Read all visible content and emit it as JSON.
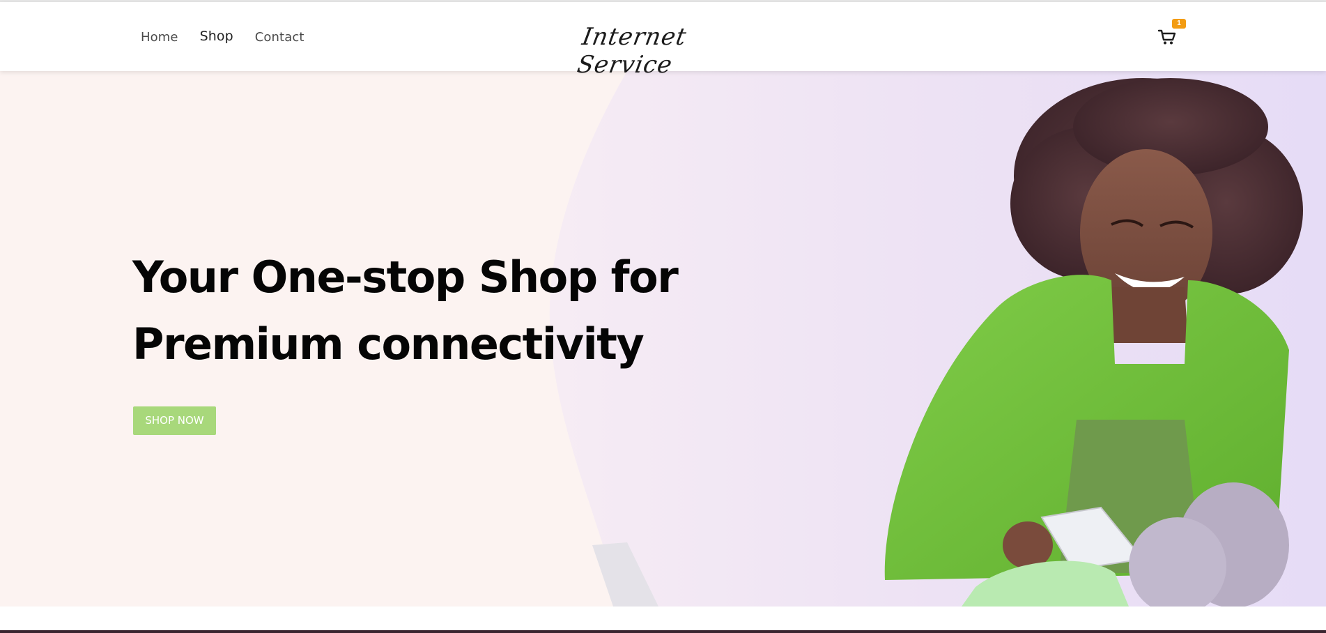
{
  "header": {
    "nav": [
      {
        "label": "Home"
      },
      {
        "label": "Shop"
      },
      {
        "label": "Contact"
      }
    ],
    "logo_text": "Internet Service",
    "cart": {
      "icon": "cart-icon",
      "count": "1"
    }
  },
  "hero": {
    "title_line1": "Your One-stop Shop for",
    "title_line2": "Premium connectivity",
    "cta_label": "SHOP NOW",
    "image": "woman-with-tablet-photo"
  },
  "colors": {
    "hero_bg": "#fcf3f1",
    "cta_bg": "#a8d87b",
    "badge_bg": "#f39c12",
    "jacket_green": "#6fbf3a"
  }
}
